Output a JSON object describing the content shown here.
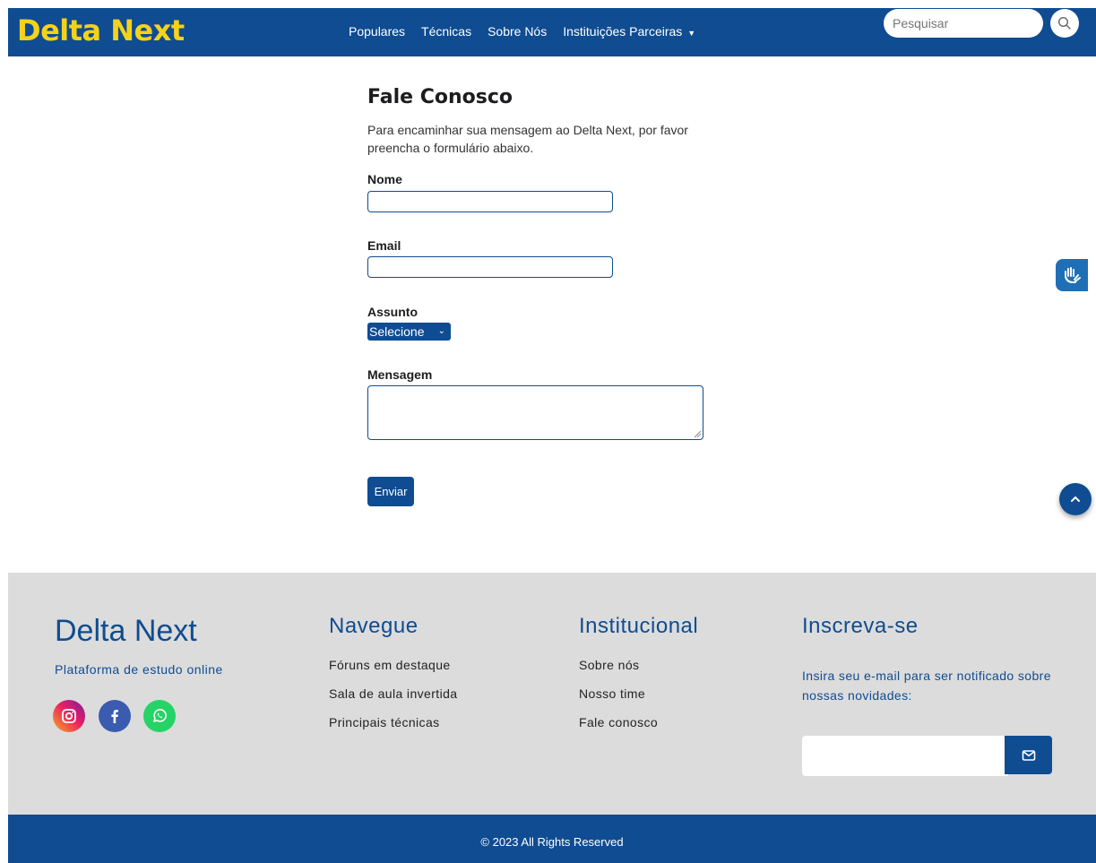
{
  "header": {
    "brand": "Delta Next",
    "nav": [
      {
        "label": "Populares"
      },
      {
        "label": "Técnicas"
      },
      {
        "label": "Sobre Nós"
      },
      {
        "label": "Instituições Parceiras"
      }
    ],
    "search": {
      "placeholder": "Pesquisar",
      "value": ""
    }
  },
  "form": {
    "title": "Fale Conosco",
    "intro": "Para encaminhar sua mensagem ao Delta Next, por favor preencha o formulário abaixo.",
    "name_label": "Nome",
    "email_label": "Email",
    "subject_label": "Assunto",
    "subject_selected": "Selecione",
    "message_label": "Mensagem",
    "submit_label": "Enviar"
  },
  "footer": {
    "brand": "Delta Next",
    "tagline": "Plataforma de estudo online",
    "social_icons": [
      "instagram-icon",
      "facebook-icon",
      "whatsapp-icon"
    ],
    "navegue": {
      "title": "Navegue",
      "links": [
        "Fóruns em destaque",
        "Sala de aula invertida",
        "Principais técnicas"
      ]
    },
    "institucional": {
      "title": "Institucional",
      "links": [
        "Sobre nós",
        "Nosso time",
        "Fale conosco"
      ]
    },
    "subscribe": {
      "title": "Inscreva-se",
      "text": "Insira seu e-mail para ser notificado sobre nossas novidades:"
    },
    "copyright": "© 2023 All Rights Reserved"
  },
  "colors": {
    "primary": "#0f4c92",
    "brand_yellow": "#f5d21a",
    "footer_bg": "#dcdcdc"
  }
}
